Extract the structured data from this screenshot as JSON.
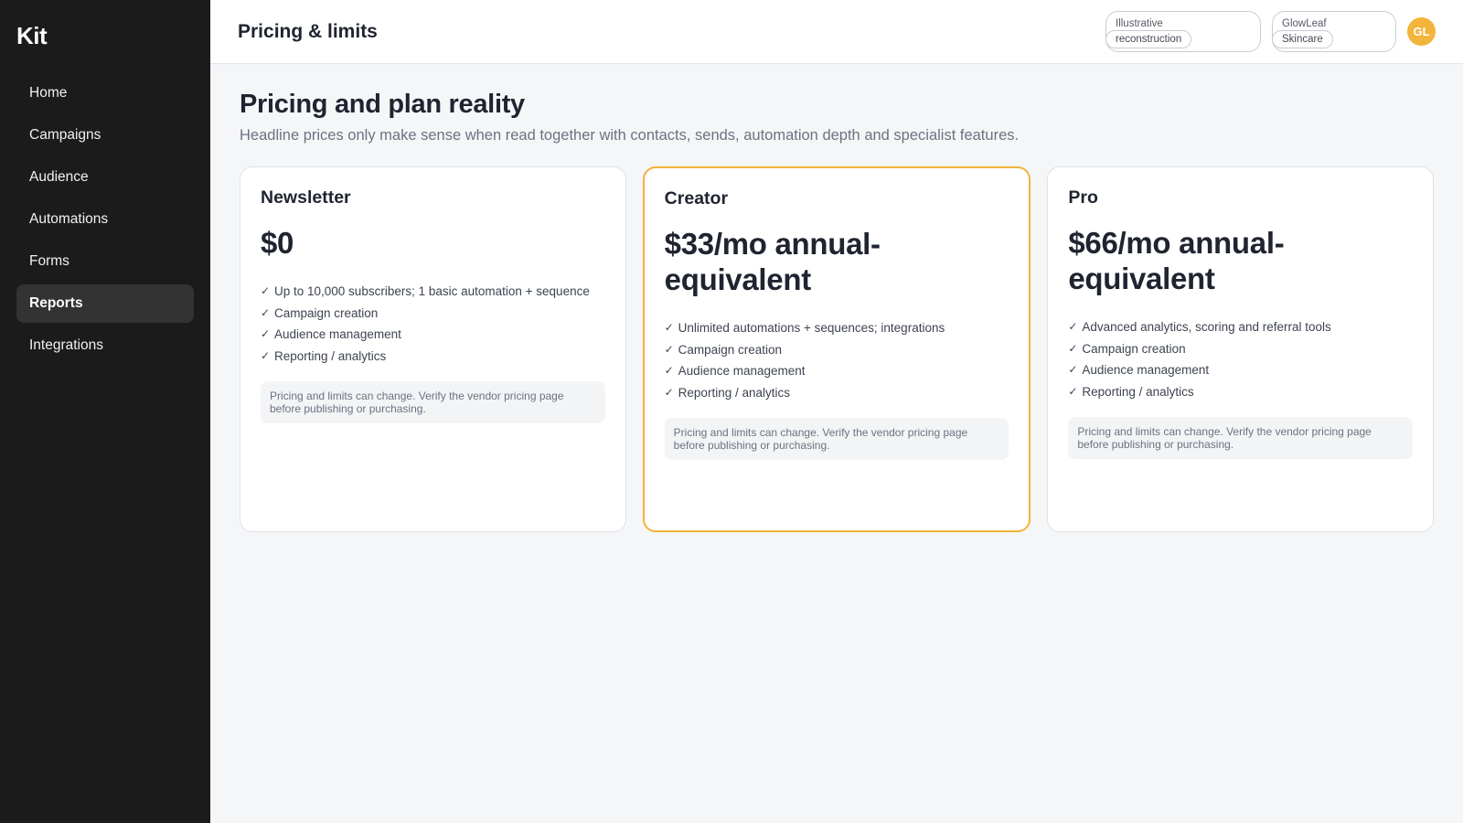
{
  "sidebar": {
    "brand": "Kit",
    "items": [
      {
        "label": "Home"
      },
      {
        "label": "Campaigns"
      },
      {
        "label": "Audience"
      },
      {
        "label": "Automations"
      },
      {
        "label": "Forms"
      },
      {
        "label": "Reports",
        "active": true
      },
      {
        "label": "Integrations"
      }
    ]
  },
  "header": {
    "title": "Pricing & limits",
    "pill1": {
      "line1": "Illustrative",
      "line2": "reconstruction"
    },
    "pill2": {
      "line1": "GlowLeaf",
      "line2": "Skincare"
    },
    "avatar": "GL"
  },
  "page": {
    "title": "Pricing and plan reality",
    "subtitle": "Headline prices only make sense when read together with contacts, sends, automation depth and specialist features."
  },
  "plans": [
    {
      "name": "Newsletter",
      "price": "$0",
      "features": [
        "Up to 10,000 subscribers; 1 basic automation + sequence",
        "Campaign creation",
        "Audience management",
        "Reporting / analytics"
      ],
      "note": "Pricing and limits can change. Verify the vendor pricing page before publishing or purchasing."
    },
    {
      "name": "Creator",
      "price": "$33/mo annual-equivalent",
      "features": [
        "Unlimited automations + sequences; integrations",
        "Campaign creation",
        "Audience management",
        "Reporting / analytics"
      ],
      "note": "Pricing and limits can change. Verify the vendor pricing page before publishing or purchasing."
    },
    {
      "name": "Pro",
      "price": "$66/mo annual-equivalent",
      "features": [
        "Advanced analytics, scoring and referral tools",
        "Campaign creation",
        "Audience management",
        "Reporting / analytics"
      ],
      "note": "Pricing and limits can change. Verify the vendor pricing page before publishing or purchasing."
    }
  ],
  "colors": {
    "accent": "#f2b43a",
    "sidebar": "#1b1b1b",
    "active_item": "#333333"
  },
  "icons": {
    "feature": "check-icon"
  }
}
